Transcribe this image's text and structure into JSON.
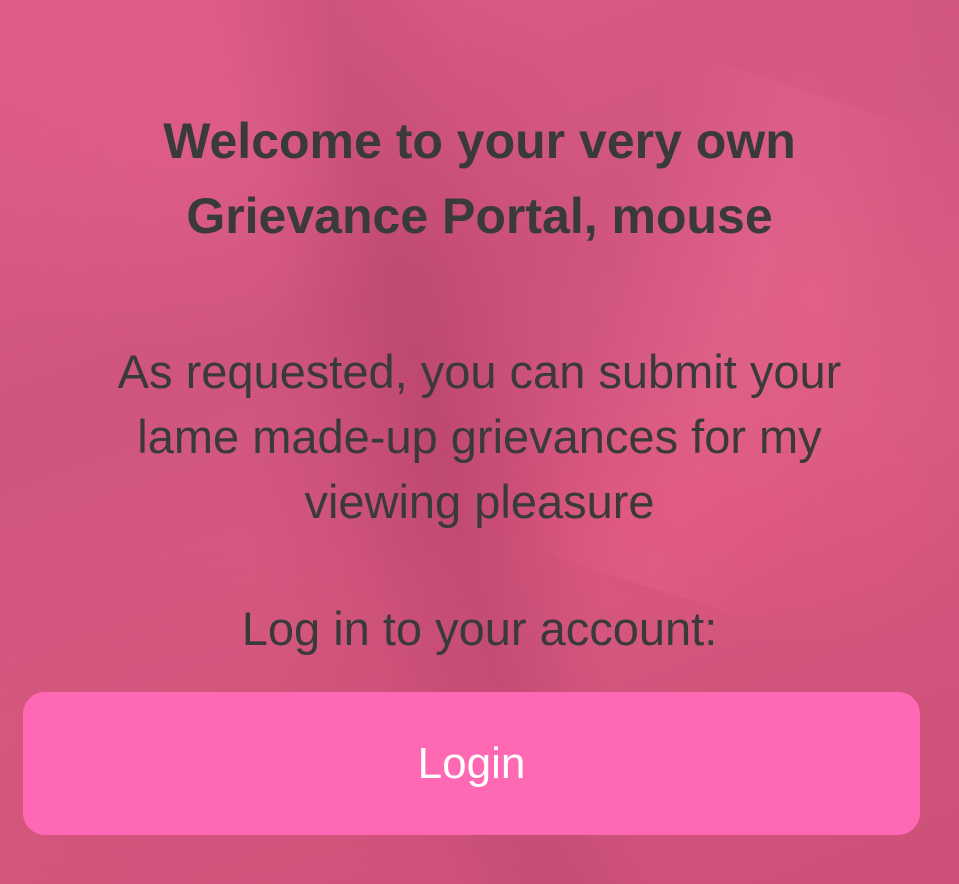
{
  "page": {
    "title_line1": "Welcome to your very own",
    "title_line2": "Grievance Portal, mouse",
    "message_line1": "As requested, you can submit your",
    "message_line2": "lame made-up grievances for my",
    "message_line3": "viewing pleasure",
    "login_prompt": "Log in to your account:"
  },
  "login_button": {
    "label": "Login"
  },
  "colors": {
    "background": "#d95880",
    "text": "#3a3a3a",
    "button": "#ff69b4",
    "button_text": "#ffffff"
  }
}
